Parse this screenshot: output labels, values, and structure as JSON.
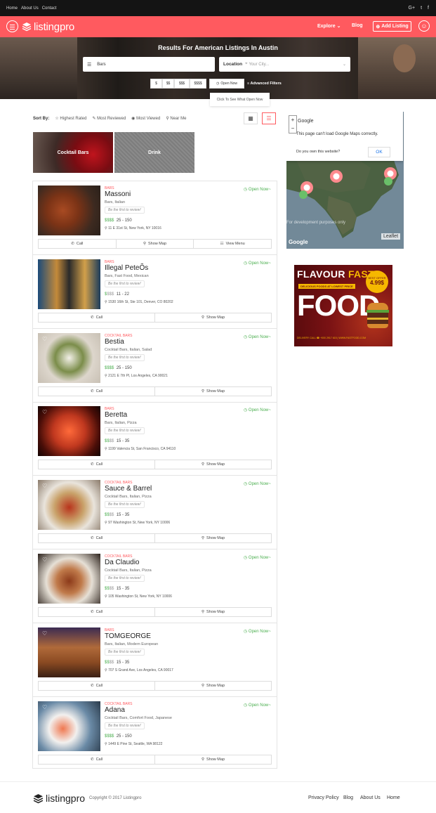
{
  "topbar": {
    "links": [
      "Home",
      "About Us",
      "Contact"
    ],
    "social": [
      "G+",
      "t",
      "f"
    ]
  },
  "header": {
    "logo": "listingpro",
    "nav": {
      "explore": "Explore",
      "blog": "Blog"
    },
    "add_listing": "Add Listing"
  },
  "hero": {
    "title_prefix": "Results For",
    "title_strong": "American",
    "title_suffix": "Listings In Austin",
    "search_value": "Bars",
    "location_label": "Location",
    "location_placeholder": "Your City...",
    "price_filters": [
      "$",
      "$$",
      "$$$",
      "$$$$"
    ],
    "open_now": "Open Now",
    "advanced_filters": "Advanced Filters",
    "tooltip": "Click To See What Open Now"
  },
  "sort": {
    "label": "Sort By:",
    "options": [
      "Highest Rated",
      "Most Reviewed",
      "Most Viewed",
      "Near Me"
    ]
  },
  "categories": [
    {
      "label": "Cocktail Bars"
    },
    {
      "label": "Drink"
    }
  ],
  "listings": [
    {
      "category": "Bars",
      "name": "Massoni",
      "tags": "Bars, Italian",
      "review": "Be the first to review!",
      "price_hi": "$$$$",
      "price_lo": "",
      "range": "25 - 150",
      "address": "11 E 31st St, New York, NY 10016",
      "open": "Open Now~",
      "actions": [
        "Call",
        "Show Map",
        "View Menu"
      ]
    },
    {
      "category": "Bars",
      "name": "Illegal PeteÕs",
      "tags": "Bars, Fast Food, Mexican",
      "review": "Be the first to review!",
      "price_hi": "$",
      "price_lo": "$$$",
      "range": "11 - 22",
      "address": "1530 16th St, Ste 101, Denver, CO 80202",
      "open": "Open Now~",
      "actions": [
        "Call",
        "Show Map"
      ]
    },
    {
      "category": "Cocktail Bars",
      "name": "Bestia",
      "tags": "Cocktail Bars, Italian, Salad",
      "review": "Be the first to review!",
      "price_hi": "$$$$",
      "price_lo": "",
      "range": "25 - 150",
      "address": "2121 E 7th Pl, Los Angeles, CA 90021",
      "open": "Open Now~",
      "actions": [
        "Call",
        "Show Map"
      ]
    },
    {
      "category": "Bars",
      "name": "Beretta",
      "tags": "Bars, Italian, Pizza",
      "review": "Be the first to review!",
      "price_hi": "$$",
      "price_lo": "$$",
      "range": "15 - 35",
      "address": "1199 Valencia St, San Francisco, CA 94110",
      "open": "Open Now~",
      "actions": [
        "Call",
        "Show Map"
      ]
    },
    {
      "category": "Cocktail Bars",
      "name": "Sauce & Barrel",
      "tags": "Cocktail Bars, Italian, Pizza",
      "review": "Be the first to review!",
      "price_hi": "$$",
      "price_lo": "$$",
      "range": "15 - 35",
      "address": "97 Washington St, New York, NY 10006",
      "open": "Open Now~",
      "actions": [
        "Call",
        "Show Map"
      ]
    },
    {
      "category": "Cocktail Bars",
      "name": "Da Claudio",
      "tags": "Cocktail Bars, Italian, Pizza",
      "review": "Be the first to review!",
      "price_hi": "$$",
      "price_lo": "$$",
      "range": "15 - 35",
      "address": "105 Washington St, New York, NY 10006",
      "open": "Open Now~",
      "actions": [
        "Call",
        "Show Map"
      ]
    },
    {
      "category": "Bars",
      "name": "TOMGEORGE",
      "tags": "Bars, Italian, Modern European",
      "review": "Be the first to review!",
      "price_hi": "$$",
      "price_lo": "$$",
      "range": "15 - 35",
      "address": "707 S Grand Ave, Los Angeles, CA 90017",
      "open": "Open Now~",
      "actions": [
        "Call",
        "Show Map"
      ]
    },
    {
      "category": "Cocktail Bars",
      "name": "Adana",
      "tags": "Cocktail Bars, Comfort Food, Japanese",
      "review": "Be the first to review!",
      "price_hi": "$$$$",
      "price_lo": "",
      "range": "25 - 150",
      "address": "1449 E Pine St, Seattle, WA 98122",
      "open": "Open Now~",
      "actions": [
        "Call",
        "Show Map"
      ]
    }
  ],
  "map": {
    "dialog_title": "Google",
    "dialog_message": "This page can't load Google Maps correctly.",
    "dialog_question": "Do you own this website?",
    "ok": "OK",
    "watermark": "For development purposes only",
    "attribution": "Leaflet",
    "brand": "Google",
    "zoom_in": "+",
    "zoom_out": "−"
  },
  "ad": {
    "line1": "FLAVOUR",
    "line2": "FAST",
    "tagline": "DELICIOUS FOODS AT LOWEST PRICE",
    "big": "FOOD",
    "badge_top": "BEST OFFER",
    "badge_price": "4.99$",
    "delivery": "DELIVERY CALL ☎ +000 2917 615 | WWW.FASTFOOD.COM"
  },
  "footer": {
    "logo": "listingpro",
    "copyright": "Copyright © 2017 Listingpro",
    "links": [
      "Privacy Policy",
      "Blog",
      "About Us",
      "Home"
    ]
  },
  "colors": {
    "brand": "#ff5a5f",
    "open": "#4caf50",
    "topbar": "#141414"
  }
}
